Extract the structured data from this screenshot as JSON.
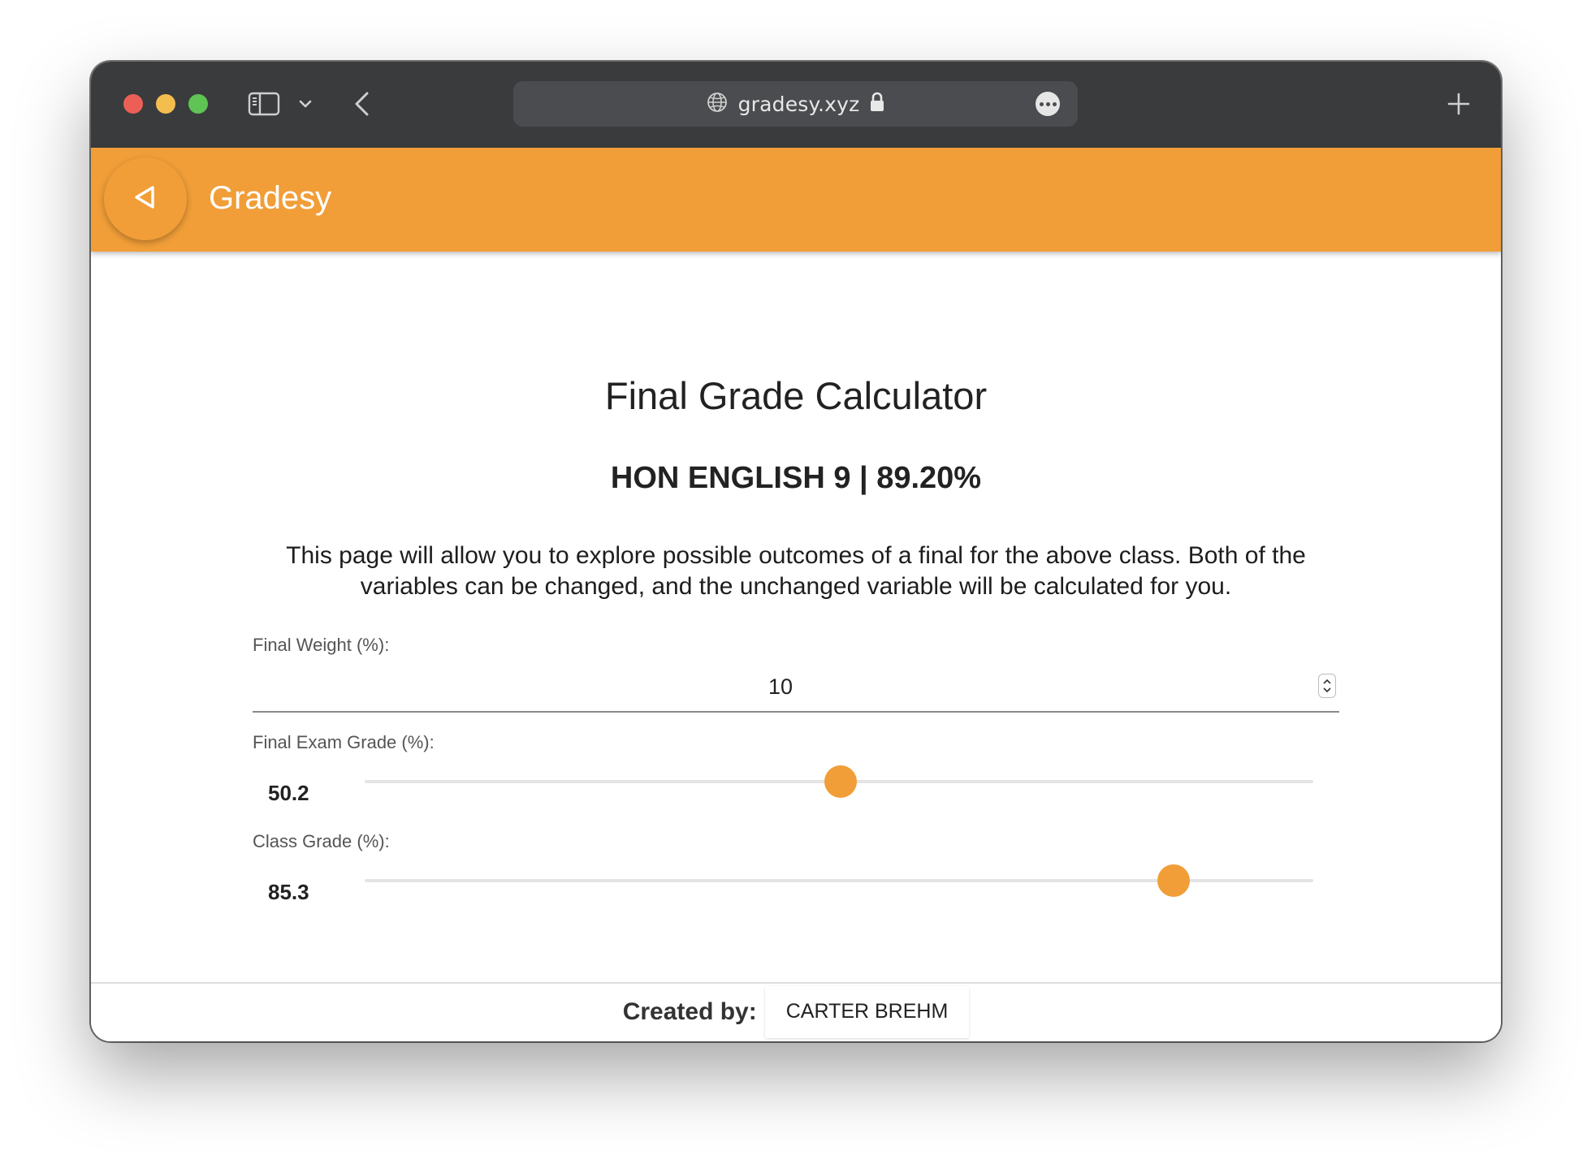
{
  "browser": {
    "url": "gradesy.xyz"
  },
  "app": {
    "title": "Gradesy",
    "accent_color": "#f19e38"
  },
  "main": {
    "page_title": "Final Grade Calculator",
    "class_heading": "HON ENGLISH 9 | 89.20%",
    "description": "This page will allow you to explore possible outcomes of a final for the above class. Both of the variables can be changed, and the unchanged variable will be calculated for you.",
    "final_weight": {
      "label": "Final Weight (%):",
      "value": "10"
    },
    "final_exam": {
      "label": "Final Exam Grade (%):",
      "value": "50.2",
      "slider_fraction": 0.502
    },
    "class_grade": {
      "label": "Class Grade (%):",
      "value": "85.3",
      "slider_fraction": 0.853
    }
  },
  "footer": {
    "created_by_label": "Created by:",
    "author": "CARTER BREHM"
  }
}
